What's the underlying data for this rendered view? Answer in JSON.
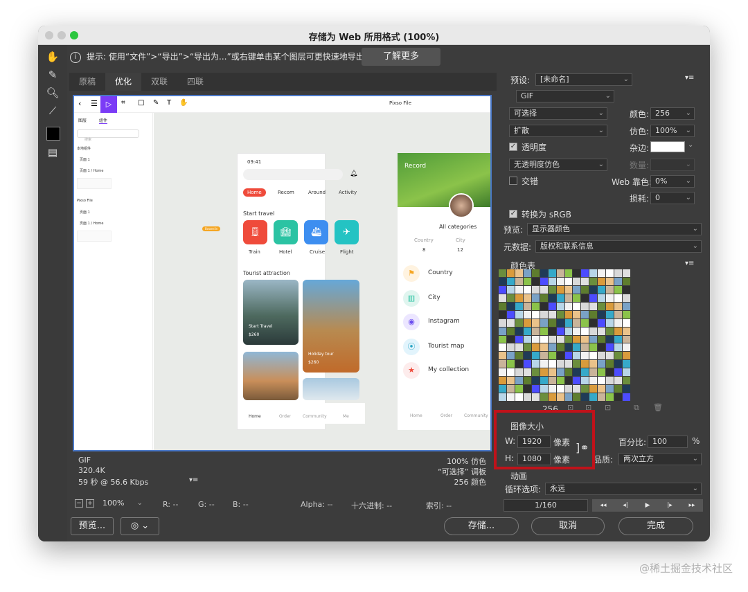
{
  "window": {
    "title": "存储为 Web 所用格式 (100%)"
  },
  "tip": {
    "text": "提示: 使用“文件”>“导出”>“导出为...”或右键单击某个图层可更快速地导出资源",
    "button": "了解更多"
  },
  "tabs": [
    "原稿",
    "优化",
    "双联",
    "四联"
  ],
  "design": {
    "file_label": "Pixso File",
    "layer_tabs": [
      "图层",
      "组件"
    ],
    "search_placeholder": "搜索",
    "tree": [
      "本地组件",
      "页面 1",
      "页面 1 / Home",
      "Pixso File",
      "页面 1",
      "页面 1 / Home"
    ],
    "cursor_tag": "Bowenlin",
    "phone1": {
      "time": "09:41",
      "chips": [
        "Home",
        "Recom",
        "Around",
        "Activity"
      ],
      "start_travel": "Start travel",
      "categories": [
        "Train",
        "Hotel",
        "Cruise",
        "Flight"
      ],
      "tourist": "Tourist attraction",
      "card1_title": "Start Travel",
      "card1_price": "$260",
      "card2_title": "Holiday tour",
      "card2_price": "$260",
      "nav": [
        "Home",
        "Order",
        "Community",
        "Me"
      ]
    },
    "phone2": {
      "back": "Record",
      "all_categories": "All categories",
      "stats": [
        {
          "label": "Country",
          "value": "8"
        },
        {
          "label": "City",
          "value": "12"
        }
      ],
      "list": [
        "Country",
        "City",
        "Instagram",
        "Tourist map",
        "My collection"
      ],
      "nav": [
        "Home",
        "Order",
        "Community"
      ]
    }
  },
  "info": {
    "format": "GIF",
    "size": "320.4K",
    "time": "59 秒 @ 56.6 Kbps",
    "dither": "100% 仿色",
    "palette_mode": "“可选择” 调板",
    "colors": "256 颜色"
  },
  "status": {
    "zoom": "100%",
    "r": "R: --",
    "g": "G: --",
    "b": "B: --",
    "alpha": "Alpha: --",
    "hex": "十六进制: --",
    "index": "索引: --"
  },
  "bottom": {
    "preview": "预览...",
    "save": "存储...",
    "cancel": "取消",
    "done": "完成"
  },
  "right": {
    "preset_label": "预设:",
    "preset_value": "[未命名]",
    "format": "GIF",
    "reduction": "可选择",
    "colors_label": "颜色:",
    "colors_value": "256",
    "dither_algo": "扩散",
    "dither_label": "仿色:",
    "dither_value": "100%",
    "transparency": "透明度",
    "matte_label": "杂边:",
    "trans_dither": "无透明度仿色",
    "amount_label": "数量:",
    "interlaced": "交错",
    "websnap_label": "Web 靠色:",
    "websnap_value": "0%",
    "lossy_label": "损耗:",
    "lossy_value": "0",
    "convert_srgb": "转换为 sRGB",
    "preview_label": "预览:",
    "preview_value": "显示器颜色",
    "metadata_label": "元数据:",
    "metadata_value": "版权和联系信息",
    "color_table_label": "颜色表",
    "color_count": "256",
    "image_size_label": "图像大小",
    "w_label": "W:",
    "w_value": "1920",
    "h_label": "H:",
    "h_value": "1080",
    "px": "像素",
    "percent_label": "百分比:",
    "percent_value": "100",
    "percent_unit": "%",
    "quality_label": "品质:",
    "quality_value": "两次立方",
    "animation_label": "动画",
    "loop_label": "循环选项:",
    "loop_value": "永远",
    "frame": "1/160"
  },
  "palette_colors": [
    "#6b8e3d",
    "#c9b49a",
    "#d9d9d9",
    "#1f3b57",
    "#f2f2f2",
    "#7aa2c6",
    "#4c4cff",
    "#d99b3c",
    "#8bc34a",
    "#e0e0e0",
    "#36a9c9",
    "#ffffff",
    "#5e7d2e",
    "#b8d6e8",
    "#eac28a",
    "#2e2e2e"
  ],
  "watermark": "@稀土掘金技术社区"
}
